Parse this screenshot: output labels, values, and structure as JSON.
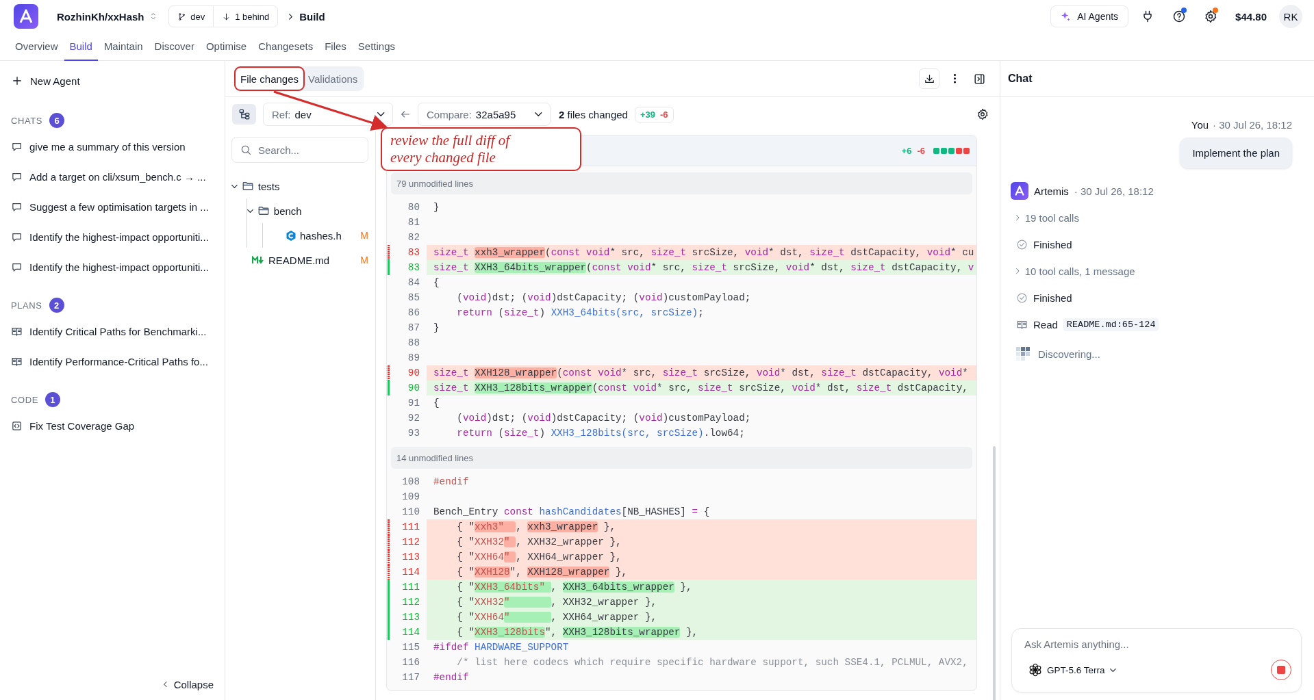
{
  "header": {
    "repo": "RozhinKh/xxHash",
    "branch": "dev",
    "behind": "1 behind",
    "page": "Build",
    "ai_button": "AI Agents",
    "help_badge": true,
    "settings_badge": true,
    "balance": "$44.80",
    "avatar": "RK"
  },
  "nav_tabs": [
    {
      "label": "Overview",
      "selected": false
    },
    {
      "label": "Build",
      "selected": true
    },
    {
      "label": "Maintain",
      "selected": false
    },
    {
      "label": "Discover",
      "selected": false
    },
    {
      "label": "Optimise",
      "selected": false
    },
    {
      "label": "Changesets",
      "selected": false
    },
    {
      "label": "Files",
      "selected": false
    },
    {
      "label": "Settings",
      "selected": false
    }
  ],
  "sidebar": {
    "new_agent": "New Agent",
    "sections": [
      {
        "title": "CHATS",
        "count": "6",
        "kind": "chat",
        "items": [
          "give me a summary of this version",
          "Add a target on cli/xsum_bench.c → ...",
          "Suggest a few optimisation targets in ...",
          "Identify the highest-impact opportuniti...",
          "Identify the highest-impact opportuniti..."
        ]
      },
      {
        "title": "PLANS",
        "count": "2",
        "kind": "plan",
        "items": [
          "Identify Critical Paths for Benchmarki...",
          "Identify Performance-Critical Paths fo..."
        ]
      },
      {
        "title": "CODE",
        "count": "1",
        "kind": "code",
        "items": [
          "Fix Test Coverage Gap"
        ]
      }
    ],
    "collapse": "Collapse"
  },
  "panel_tabs": [
    {
      "label": "File changes",
      "selected": true,
      "annotated": true
    },
    {
      "label": "Validations",
      "selected": false,
      "annotated": false
    }
  ],
  "compare_bar": {
    "ref_label": "Ref:",
    "ref": "dev",
    "compare_label": "Compare:",
    "compare": "32a5a95",
    "files_count": "2",
    "files_text": "files changed",
    "additions": "+39",
    "deletions": "-6"
  },
  "search": {
    "placeholder": "Search..."
  },
  "file_tree": [
    {
      "name": "tests",
      "kind": "folder",
      "expanded": true,
      "children": [
        {
          "name": "bench",
          "kind": "folder",
          "expanded": true,
          "children": [
            {
              "name": "hashes.h",
              "kind": "c-header",
              "status": "M"
            }
          ]
        }
      ]
    },
    {
      "name": "README.md",
      "kind": "markdown",
      "status": "M"
    }
  ],
  "diff": {
    "additions": "+6",
    "deletions": "-6",
    "blocks": [
      {
        "kind": "added"
      },
      {
        "kind": "added"
      },
      {
        "kind": "added"
      },
      {
        "kind": "removed"
      },
      {
        "kind": "removed"
      }
    ],
    "hunks": [
      {
        "kind": "collapsed",
        "text": "79 unmodified lines"
      },
      {
        "kind": "lines",
        "lines": [
          {
            "num": "80",
            "kind": "context",
            "segments": [
              {
                "text": "}"
              }
            ]
          },
          {
            "num": "81",
            "kind": "context"
          },
          {
            "num": "82",
            "kind": "context"
          },
          {
            "num": "83",
            "kind": "removed",
            "segments": [
              {
                "text": "size_t ",
                "kind": "type"
              },
              {
                "text": "xxh3_wrapper",
                "changed": true
              },
              {
                "text": "("
              },
              {
                "text": "const void",
                "kind": "type"
              },
              {
                "text": "* src, "
              },
              {
                "text": "size_t",
                "kind": "type"
              },
              {
                "text": " srcSize, "
              },
              {
                "text": "void",
                "kind": "type"
              },
              {
                "text": "* dst, "
              },
              {
                "text": "size_t",
                "kind": "type"
              },
              {
                "text": " dstCapacity, "
              },
              {
                "text": "void",
                "kind": "type"
              },
              {
                "text": "* cu"
              }
            ]
          },
          {
            "num": "83",
            "kind": "added",
            "segments": [
              {
                "text": "size_t ",
                "kind": "type"
              },
              {
                "text": "XXH3_64bits_wrapper",
                "changed": true
              },
              {
                "text": "("
              },
              {
                "text": "const void",
                "kind": "type"
              },
              {
                "text": "* src, "
              },
              {
                "text": "size_t",
                "kind": "type"
              },
              {
                "text": " srcSize, "
              },
              {
                "text": "void",
                "kind": "type"
              },
              {
                "text": "* dst, "
              },
              {
                "text": "size_t",
                "kind": "type"
              },
              {
                "text": " dstCapacity, "
              },
              {
                "text": "v",
                "kind": "type"
              }
            ]
          },
          {
            "num": "84",
            "kind": "context",
            "segments": [
              {
                "text": "{"
              }
            ]
          },
          {
            "num": "85",
            "kind": "context",
            "segments": [
              {
                "text": "    ("
              },
              {
                "text": "void",
                "kind": "type"
              },
              {
                "text": ")dst; ("
              },
              {
                "text": "void",
                "kind": "type"
              },
              {
                "text": ")dstCapacity; ("
              },
              {
                "text": "void",
                "kind": "type"
              },
              {
                "text": ")customPayload;"
              }
            ]
          },
          {
            "num": "86",
            "kind": "context",
            "segments": [
              {
                "text": "    return",
                "kind": "type"
              },
              {
                "text": " ("
              },
              {
                "text": "size_t",
                "kind": "type"
              },
              {
                "text": ") "
              },
              {
                "text": "XXH3_64bits(src, srcSize)",
                "kind": "func"
              },
              {
                "text": ";"
              }
            ]
          },
          {
            "num": "87",
            "kind": "context",
            "segments": [
              {
                "text": "}"
              }
            ]
          },
          {
            "num": "88",
            "kind": "context"
          },
          {
            "num": "89",
            "kind": "context"
          },
          {
            "num": "90",
            "kind": "removed",
            "segments": [
              {
                "text": "size_t ",
                "kind": "type"
              },
              {
                "text": "XXH128_wrapper",
                "changed": true
              },
              {
                "text": "("
              },
              {
                "text": "const void",
                "kind": "type"
              },
              {
                "text": "* src, "
              },
              {
                "text": "size_t",
                "kind": "type"
              },
              {
                "text": " srcSize, "
              },
              {
                "text": "void",
                "kind": "type"
              },
              {
                "text": "* dst, "
              },
              {
                "text": "size_t",
                "kind": "type"
              },
              {
                "text": " dstCapacity, "
              },
              {
                "text": "void",
                "kind": "type"
              },
              {
                "text": "*"
              }
            ]
          },
          {
            "num": "90",
            "kind": "added",
            "segments": [
              {
                "text": "size_t ",
                "kind": "type"
              },
              {
                "text": "XXH3_128bits_wrapper",
                "changed": true
              },
              {
                "text": "("
              },
              {
                "text": "const void",
                "kind": "type"
              },
              {
                "text": "* src, "
              },
              {
                "text": "size_t",
                "kind": "type"
              },
              {
                "text": " srcSize, "
              },
              {
                "text": "void",
                "kind": "type"
              },
              {
                "text": "* dst, "
              },
              {
                "text": "size_t",
                "kind": "type"
              },
              {
                "text": " dstCapacity,"
              }
            ]
          },
          {
            "num": "91",
            "kind": "context",
            "segments": [
              {
                "text": "{"
              }
            ]
          },
          {
            "num": "92",
            "kind": "context",
            "segments": [
              {
                "text": "    ("
              },
              {
                "text": "void",
                "kind": "type"
              },
              {
                "text": ")dst; ("
              },
              {
                "text": "void",
                "kind": "type"
              },
              {
                "text": ")dstCapacity; ("
              },
              {
                "text": "void",
                "kind": "type"
              },
              {
                "text": ")customPayload;"
              }
            ]
          },
          {
            "num": "93",
            "kind": "context",
            "segments": [
              {
                "text": "    return",
                "kind": "type"
              },
              {
                "text": " ("
              },
              {
                "text": "size_t",
                "kind": "type"
              },
              {
                "text": ") "
              },
              {
                "text": "XXH3_128bits(src, srcSize)",
                "kind": "func"
              },
              {
                "text": ".low64;"
              }
            ]
          }
        ]
      },
      {
        "kind": "collapsed",
        "text": "14 unmodified lines"
      },
      {
        "kind": "lines",
        "lines": [
          {
            "num": "108",
            "kind": "context",
            "segments": [
              {
                "text": "#endif",
                "kind": "macro"
              }
            ]
          },
          {
            "num": "109",
            "kind": "context"
          },
          {
            "num": "110",
            "kind": "context",
            "segments": [
              {
                "text": "Bench_Entry "
              },
              {
                "text": "const ",
                "kind": "type"
              },
              {
                "text": "hashCandidates",
                "kind": "func"
              },
              {
                "text": "[NB_HASHES] "
              },
              {
                "text": "=",
                "kind": "type"
              },
              {
                "text": " {"
              }
            ]
          },
          {
            "num": "111",
            "kind": "removed",
            "segments": [
              {
                "text": "    { \""
              },
              {
                "text": "xxh3\"  ",
                "kind": "string",
                "changed": true
              },
              {
                "text": ", "
              },
              {
                "text": "xxh3_wrapper",
                "changed": true
              },
              {
                "text": " },"
              }
            ]
          },
          {
            "num": "112",
            "kind": "removed",
            "segments": [
              {
                "text": "    { \""
              },
              {
                "text": "XXH32",
                "kind": "string"
              },
              {
                "text": "\" ",
                "kind": "string",
                "changed": true
              },
              {
                "text": ", XXH32_wrapper },"
              }
            ]
          },
          {
            "num": "113",
            "kind": "removed",
            "segments": [
              {
                "text": "    { \""
              },
              {
                "text": "XXH64",
                "kind": "string"
              },
              {
                "text": "\" ",
                "kind": "string",
                "changed": true
              },
              {
                "text": ", XXH64_wrapper },"
              }
            ]
          },
          {
            "num": "114",
            "kind": "removed",
            "segments": [
              {
                "text": "    { \""
              },
              {
                "text": "XXH128",
                "kind": "string",
                "changed": true
              },
              {
                "text": "\", "
              },
              {
                "text": "XXH128_wrapper",
                "changed": true
              },
              {
                "text": " },"
              }
            ]
          },
          {
            "num": "111",
            "kind": "added",
            "segments": [
              {
                "text": "    { \""
              },
              {
                "text": "XXH3_64bits\" ",
                "kind": "string",
                "changed": true
              },
              {
                "text": ", "
              },
              {
                "text": "XXH3_64bits_wrapper",
                "changed": true
              },
              {
                "text": " },"
              }
            ]
          },
          {
            "num": "112",
            "kind": "added",
            "segments": [
              {
                "text": "    { \""
              },
              {
                "text": "XXH32",
                "kind": "string"
              },
              {
                "text": "\"       ",
                "kind": "string",
                "changed": true
              },
              {
                "text": ", XXH32_wrapper },"
              }
            ]
          },
          {
            "num": "113",
            "kind": "added",
            "segments": [
              {
                "text": "    { \""
              },
              {
                "text": "XXH64",
                "kind": "string"
              },
              {
                "text": "\"       ",
                "kind": "string",
                "changed": true
              },
              {
                "text": ", XXH64_wrapper },"
              }
            ]
          },
          {
            "num": "114",
            "kind": "added",
            "segments": [
              {
                "text": "    { \""
              },
              {
                "text": "XXH3_128bits",
                "kind": "string",
                "changed": true
              },
              {
                "text": "\", "
              },
              {
                "text": "XXH3_128bits_wrapper",
                "changed": true
              },
              {
                "text": " },"
              }
            ]
          },
          {
            "num": "115",
            "kind": "context",
            "segments": [
              {
                "text": "#ifdef ",
                "kind": "type"
              },
              {
                "text": "HARDWARE_SUPPORT",
                "kind": "func"
              }
            ]
          },
          {
            "num": "116",
            "kind": "context",
            "segments": [
              {
                "text": "    /* list here codecs which require specific hardware support, such SSE4.1, PCLMUL, AVX2,",
                "kind": "comment"
              }
            ]
          },
          {
            "num": "117",
            "kind": "context",
            "segments": [
              {
                "text": "#endif",
                "kind": "type"
              }
            ]
          }
        ]
      }
    ]
  },
  "annotation": {
    "text": "review the full diff of every changed file"
  },
  "chat": {
    "title": "Chat",
    "messages": [
      {
        "kind": "user",
        "author": "You",
        "time": "· 30 Jul 26, 18:12",
        "text": "Implement the plan"
      },
      {
        "kind": "agent",
        "author": "Artemis",
        "time": "· 30 Jul 26, 18:12",
        "steps": [
          {
            "kind": "toggle",
            "text": "19 tool calls"
          },
          {
            "kind": "done",
            "text": "Finished"
          },
          {
            "kind": "toggle",
            "text": "10 tool calls, 1 message"
          },
          {
            "kind": "done",
            "text": "Finished"
          },
          {
            "kind": "read",
            "text": "Read",
            "code": "README.md:65-124"
          },
          {
            "kind": "progress",
            "text": "Discovering..."
          }
        ]
      }
    ],
    "input": {
      "placeholder": "Ask Artemis anything...",
      "model": "GPT-5.6 Terra"
    }
  }
}
